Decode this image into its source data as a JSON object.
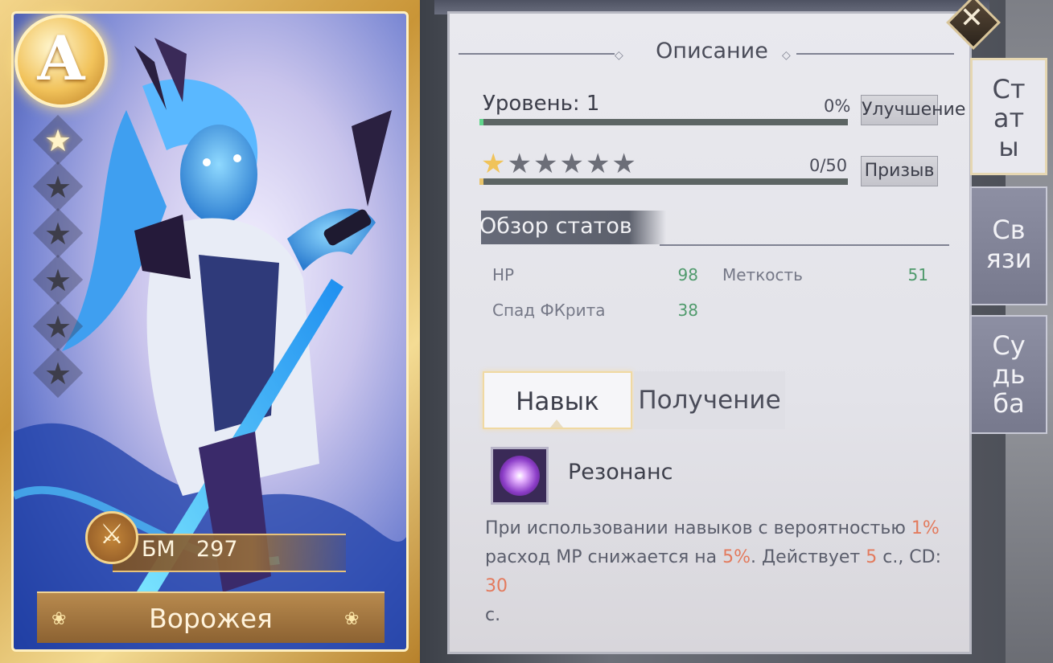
{
  "card": {
    "grade": "A",
    "stars_total": 6,
    "stars_lit": 1,
    "star_glyph": "★",
    "bm_label": "БМ",
    "bm_value": "297",
    "bm_icon": "crossed-swords-icon",
    "name": "Ворожея"
  },
  "panel": {
    "title": "Описание",
    "close_icon": "close-icon",
    "level_label": "Уровень: 1",
    "level_progress": "0%",
    "level_progress_value": 0.01,
    "upgrade_button": "Улучшение",
    "stars_progress": "0/50",
    "stars_progress_value": 0.01,
    "summon_button": "Призыв",
    "overview_title": "Обзор статов",
    "stats": [
      {
        "label": "HP",
        "value": "98"
      },
      {
        "label": "Меткость",
        "value": "51"
      },
      {
        "label": "Спад ФКрита",
        "value": "38"
      }
    ],
    "tabs": [
      {
        "label": "Навык",
        "active": true
      },
      {
        "label": "Получение",
        "active": false
      }
    ],
    "skill": {
      "icon": "resonance-orb-icon",
      "name": "Резонанс",
      "desc_1": "При использовании навыков с вероятностью ",
      "desc_hl_1": "1%",
      "desc_2": "расход MP снижается на ",
      "desc_hl_2": "5%",
      "desc_3": ". Действует ",
      "desc_hl_3": "5",
      "desc_4": " с., CD: ",
      "desc_hl_4": "30",
      "desc_5": "с."
    }
  },
  "side_tabs": [
    {
      "lines": [
        "Ст",
        "ат",
        "ы"
      ],
      "active": true
    },
    {
      "lines": [
        "Св",
        "язи"
      ],
      "active": false
    },
    {
      "lines": [
        "Су",
        "дь",
        "ба"
      ],
      "active": false
    }
  ],
  "colors": {
    "bar_fill": "#5fd58b",
    "stat_value": "#4f9a6c",
    "highlight": "#e37a5d",
    "star_on": "#f0c35a"
  }
}
